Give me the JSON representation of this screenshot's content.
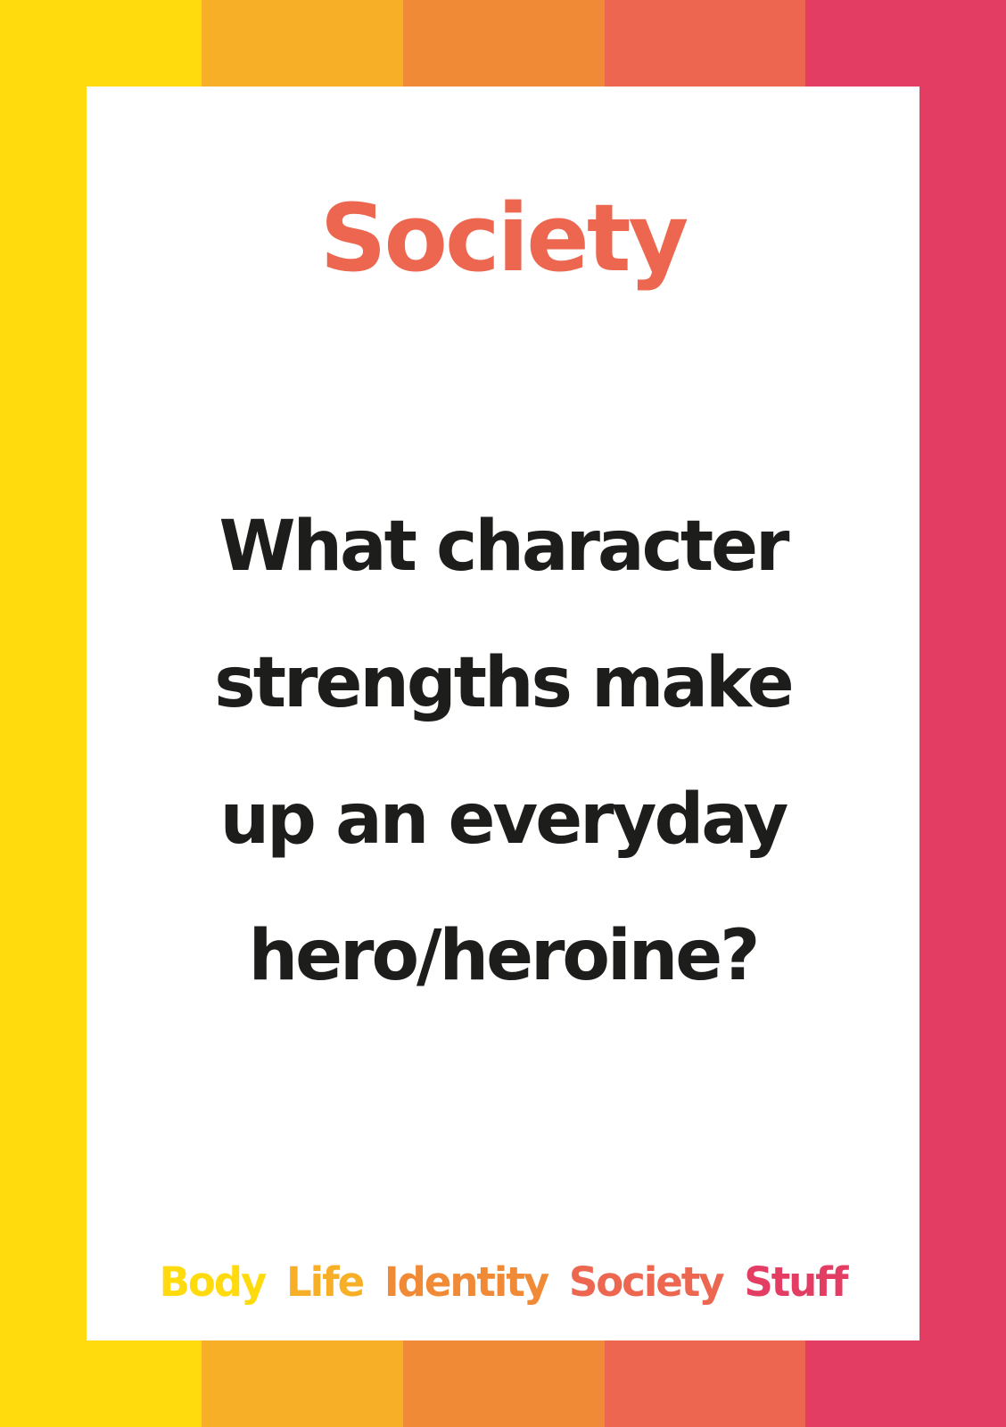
{
  "colors": {
    "stripes": [
      "#ffdb0e",
      "#f7af27",
      "#f18a36",
      "#ec6650",
      "#e43d63"
    ],
    "card_background": "#ffffff",
    "title": "#ec6650",
    "question_text": "#1d1d1b"
  },
  "card": {
    "category_title": "Society",
    "question_lines": [
      "What character",
      "strengths make",
      "up an everyday",
      "hero/heroine?"
    ]
  },
  "footer": {
    "items": [
      {
        "label": "Body",
        "color": "#ffdb0e"
      },
      {
        "label": "Life",
        "color": "#f7af27"
      },
      {
        "label": "Identity",
        "color": "#f18a36"
      },
      {
        "label": "Society",
        "color": "#ec6650"
      },
      {
        "label": "Stuff",
        "color": "#e43d63"
      }
    ]
  }
}
